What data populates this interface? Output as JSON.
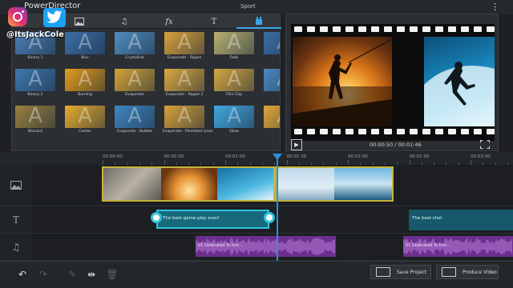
{
  "app": {
    "title": "PowerDirector",
    "document_title": "Sport"
  },
  "overlay": {
    "handle": "@ItsJackCole"
  },
  "effects_panel": {
    "tabs": [
      {
        "icon": "image-icon"
      },
      {
        "icon": "music-note-icon"
      },
      {
        "label": "fx"
      },
      {
        "label": "T"
      },
      {
        "icon": "transition-icon",
        "active": true
      }
    ],
    "items": [
      {
        "label": "Binary 1",
        "color": "#4a7fb6"
      },
      {
        "label": "Blur",
        "color": "#3a6fa8"
      },
      {
        "label": "Crystallize",
        "color": "#4f8dc2"
      },
      {
        "label": "Evaporate - Ripple",
        "color": "#d8a13a"
      },
      {
        "label": "Fade",
        "color": "#b9b070"
      },
      {
        "label": "",
        "color": "#3b6ea5"
      },
      {
        "label": "Binary 2",
        "color": "#3f78b0"
      },
      {
        "label": "Burning",
        "color": "#e39a1b"
      },
      {
        "label": "Evaporate",
        "color": "#d3a236"
      },
      {
        "label": "Evaporate - Ripple 2",
        "color": "#d8a83e"
      },
      {
        "label": "Film Clip",
        "color": "#d4a640"
      },
      {
        "label": "Mi",
        "color": "#4a87c0"
      },
      {
        "label": "Blizzard",
        "color": "#9a7f3d"
      },
      {
        "label": "Center",
        "color": "#e6aa2e"
      },
      {
        "label": "Evaporate - Bubble",
        "color": "#3f86c2"
      },
      {
        "label": "Evaporate - Pixelated Lines",
        "color": "#d4a03a"
      },
      {
        "label": "Glow",
        "color": "#41a8e0"
      },
      {
        "label": "Pag",
        "color": "#e0a63a"
      }
    ]
  },
  "preview": {
    "time": "00:00:50 / 00:01:46"
  },
  "timeline": {
    "ruler": [
      "00:00:00",
      "00:00:30",
      "00:01:00",
      "00:01:30",
      "00:02:00",
      "00:02:30",
      "00:03:00"
    ],
    "title_clip_1": "The best game play ever!",
    "title_clip_2": "The best shot",
    "audio_clip_1": "01 Dedicated To Inm...",
    "audio_clip_2": "01 Dedicated To Inm..."
  },
  "bottom_bar": {
    "save_label": "Save Project",
    "produce_label": "Produce Video"
  }
}
